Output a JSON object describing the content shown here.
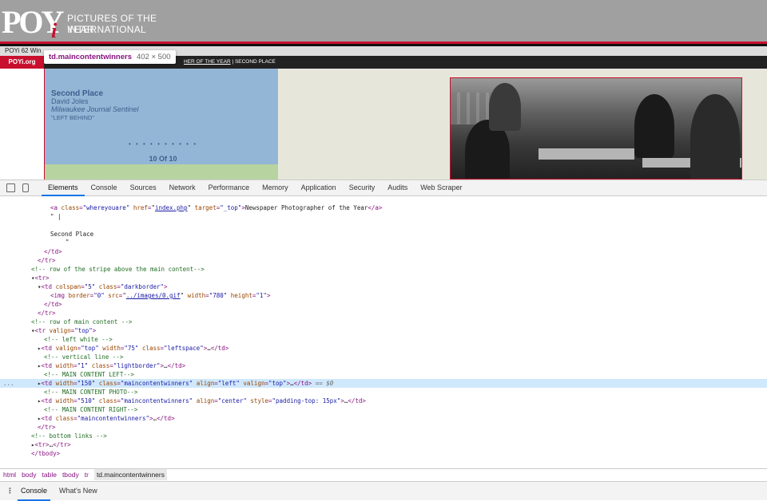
{
  "site": {
    "logo_letters": "POY",
    "logo_i": "i",
    "logo_line1": "PICTURES OF THE YEAR",
    "logo_line2": "INTERNATIONAL",
    "subtitle": "POYi 62 Win",
    "nav_tab": "POYi.org",
    "breadcrumb_link": "HER OF THE YEAR",
    "breadcrumb_rest": " | SECOND PLACE",
    "colors": {
      "brand_red": "#c8102e",
      "panel_blue": "#94b6d6",
      "panel_green": "#b7d4a0",
      "page_bg": "#e6e7da"
    }
  },
  "winner": {
    "place": "Second Place",
    "photographer": "David Joles",
    "publication": "Milwaukee Journal Sentinel",
    "title": "\"LEFT BEHIND\"",
    "dots": "• • • • • • • • • •",
    "counter": "10 Of 10"
  },
  "hover_tooltip": {
    "selector": "td.maincontentwinners",
    "dimensions": "402 × 500"
  },
  "devtools": {
    "tabs": [
      "Elements",
      "Console",
      "Sources",
      "Network",
      "Performance",
      "Memory",
      "Application",
      "Security",
      "Audits",
      "Web Scraper"
    ],
    "active_tab": "Elements",
    "breadcrumb": [
      "html",
      "body",
      "table",
      "tbody",
      "tr",
      "td.maincontentwinners"
    ],
    "drawer_tabs": [
      "Console",
      "What's New"
    ],
    "drawer_menu_glyph": "⋮",
    "selected_marker": "...",
    "elements": {
      "l0_href": "index.php",
      "l0_text": "Newspaper Photographer of the Year",
      "l1_text": "\" |",
      "l2_text": "Second Place",
      "l3_text": "\"",
      "c_stripe": "<!-- row of the stripe above the main content-->",
      "img_src": "../images/0.gif",
      "c_main": "<!-- row of main content -->",
      "c_leftwhite": "<!-- left white -->",
      "c_vline": "<!-- vertical line -->",
      "c_mcleft": "<!-- MAIN CONTENT LEFT-->",
      "c_mcphoto": "<!-- MAIN CONTENT PHOTO-->",
      "c_mcright": "<!-- MAIN CONTENT RIGHT-->",
      "c_bottom": "<!-- bottom links -->",
      "eq_marker": "== $0"
    }
  }
}
